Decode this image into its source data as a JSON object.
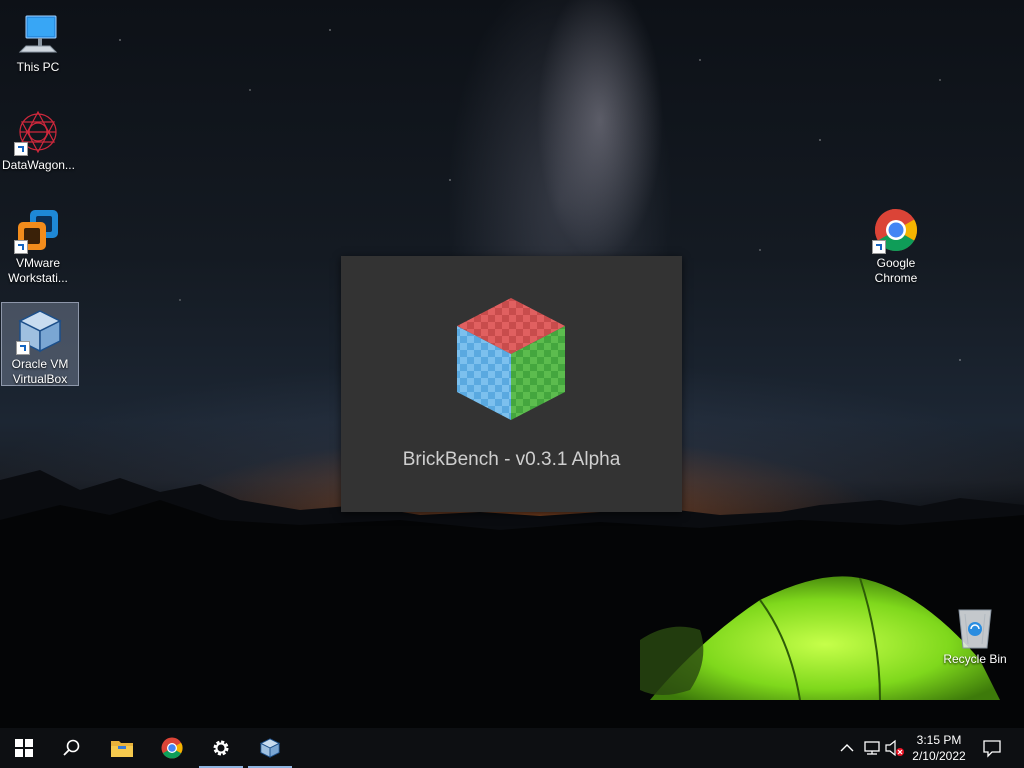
{
  "desktop": {
    "icons": [
      {
        "label": "This PC",
        "icon": "computer-icon"
      },
      {
        "label": "DataWagon...",
        "icon": "datawagon-icon"
      },
      {
        "label": "VMware Workstati...",
        "icon": "vmware-icon"
      },
      {
        "label": "Oracle VM VirtualBox",
        "icon": "virtualbox-icon"
      },
      {
        "label": "Google Chrome",
        "icon": "chrome-icon"
      },
      {
        "label": "Recycle Bin",
        "icon": "recycle-bin-icon"
      }
    ]
  },
  "splash": {
    "title": "BrickBench - v0.3.1 Alpha",
    "colors": {
      "top": "#e06060",
      "left": "#5aa9e0",
      "right": "#44a63e",
      "background": "#333333"
    }
  },
  "taskbar": {
    "items": [
      "start-icon",
      "search-icon",
      "file-explorer-icon",
      "chrome-icon",
      "settings-icon",
      "virtualbox-icon"
    ],
    "clock": {
      "time": "3:15 PM",
      "date": "2/10/2022"
    }
  }
}
